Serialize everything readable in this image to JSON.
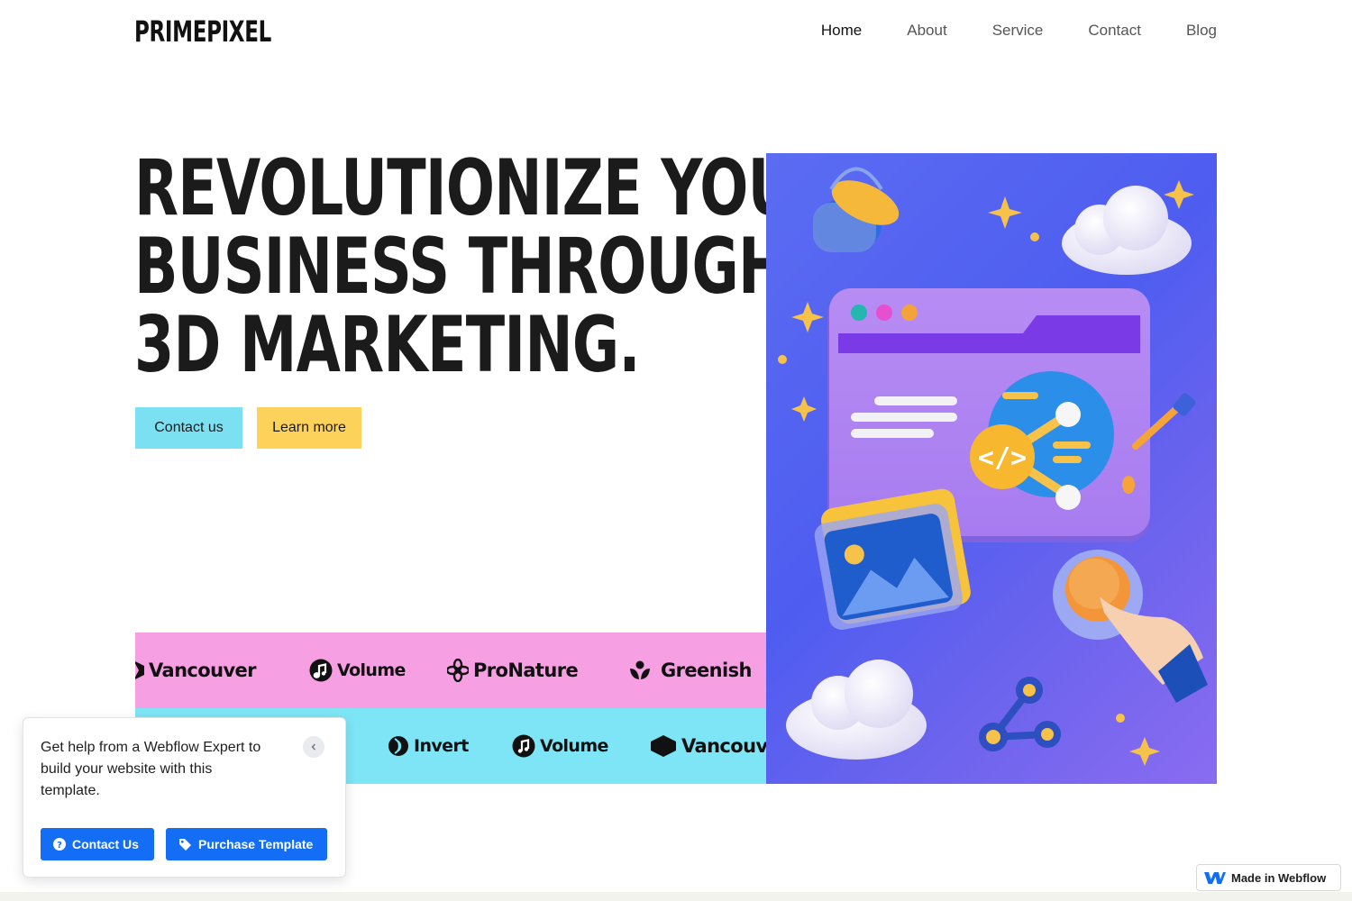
{
  "header": {
    "logo": "PRIMEPIXEL",
    "nav": [
      {
        "label": "Home",
        "active": true
      },
      {
        "label": "About",
        "active": false
      },
      {
        "label": "Service",
        "active": false
      },
      {
        "label": "Contact",
        "active": false
      },
      {
        "label": "Blog",
        "active": false
      }
    ]
  },
  "hero": {
    "title_lines": [
      "REVOLUTIONIZE YOUR",
      "BUSINESS THROUGH",
      "3D MARKETING."
    ],
    "contact_button": "Contact us",
    "learn_button": "Learn more",
    "colors": {
      "contact": "#7ce0f3",
      "learn": "#fdd25a",
      "band_pink": "#f79fe3",
      "band_cyan": "#7de5f5",
      "art_bg": "#5b6cf2"
    }
  },
  "logo_bands": {
    "pink": [
      {
        "name": "Vancouver",
        "icon": "vancouver-logo-icon"
      },
      {
        "name": "Volume",
        "icon": "music-note-icon"
      },
      {
        "name": "ProNature",
        "icon": "flower-icon"
      },
      {
        "name": "Greenish",
        "icon": "sprout-icon"
      }
    ],
    "cyan": [
      {
        "name": "Invert",
        "icon": "invert-logo-icon"
      },
      {
        "name": "Volume",
        "icon": "music-note-icon"
      },
      {
        "name": "Vancouver",
        "icon": "vancouver-logo-icon"
      }
    ]
  },
  "popup": {
    "text": "Get help from a Webflow Expert to build your website with this template.",
    "contact_button": "Contact Us",
    "purchase_button": "Purchase Template"
  },
  "badge": {
    "label": "Made in Webflow"
  }
}
